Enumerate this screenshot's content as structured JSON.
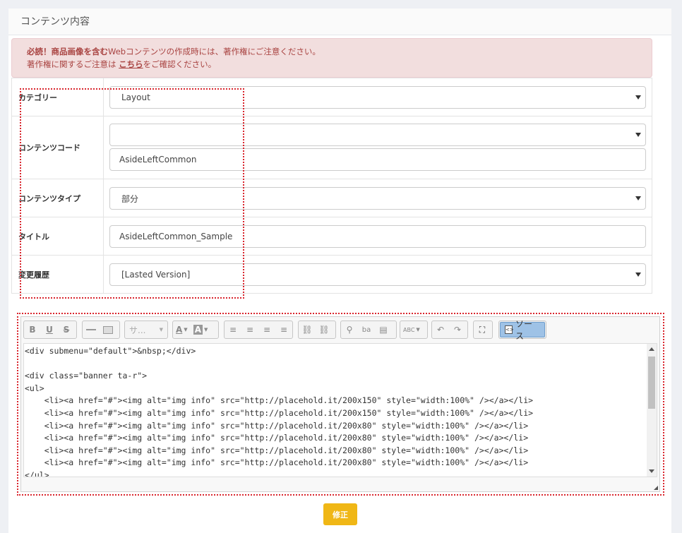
{
  "card": {
    "title": "コンテンツ内容"
  },
  "alert": {
    "line1_bold": "必読！商品画像を含む",
    "line1_rest": "Webコンテンツの作成時には、著作権にご注意ください。",
    "line2_pre": "著作権に関するご注意は ",
    "line2_link": "こちら",
    "line2_post": "をご確認ください。"
  },
  "form": {
    "category": {
      "label": "カテゴリー",
      "value": "Layout"
    },
    "content_code": {
      "label": "コンテンツコード",
      "select_value": "",
      "input_value": "AsideLeftCommon"
    },
    "content_type": {
      "label": "コンテンツタイプ",
      "value": "部分"
    },
    "title": {
      "label": "タイトル",
      "value": "AsideLeftCommon_Sample"
    },
    "history": {
      "label": "変更履歴",
      "value": "[Lasted Version]"
    }
  },
  "toolbar": {
    "bold": "B",
    "underline": "U",
    "strike": "S",
    "format_placeholder": "サ...",
    "text_color": "A",
    "bg_color": "A",
    "spellcheck": "ABC",
    "source_label": "ソース"
  },
  "editor": {
    "code": "<div submenu=\"default\">&nbsp;</div>\n\n<div class=\"banner ta-r\">\n<ul>\n    <li><a href=\"#\"><img alt=\"img info\" src=\"http://placehold.it/200x150\" style=\"width:100%\" /></a></li>\n    <li><a href=\"#\"><img alt=\"img info\" src=\"http://placehold.it/200x150\" style=\"width:100%\" /></a></li>\n    <li><a href=\"#\"><img alt=\"img info\" src=\"http://placehold.it/200x80\" style=\"width:100%\" /></a></li>\n    <li><a href=\"#\"><img alt=\"img info\" src=\"http://placehold.it/200x80\" style=\"width:100%\" /></a></li>\n    <li><a href=\"#\"><img alt=\"img info\" src=\"http://placehold.it/200x80\" style=\"width:100%\" /></a></li>\n    <li><a href=\"#\"><img alt=\"img info\" src=\"http://placehold.it/200x80\" style=\"width:100%\" /></a></li>\n</ul>"
  },
  "submit": {
    "label": "修正"
  },
  "colors": {
    "alert_bg": "#f2dede",
    "alert_text": "#a94442",
    "highlight": "#d9262e",
    "submit": "#f0b716",
    "source_active": "#9ec2e6"
  }
}
